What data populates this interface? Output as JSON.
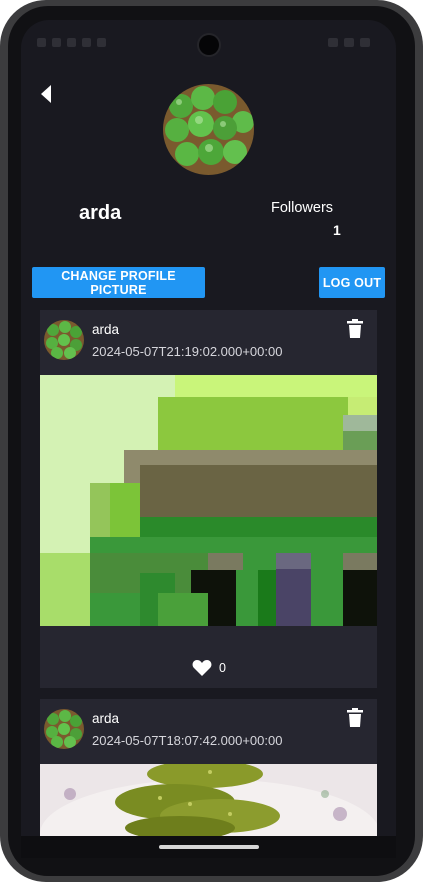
{
  "profile": {
    "username": "arda",
    "followers_label": "Followers",
    "followers_count": "1",
    "avatar_icon": "green-peas-avatar"
  },
  "buttons": {
    "change_picture": "CHANGE PROFILE PICTURE",
    "logout": "LOG OUT"
  },
  "posts": [
    {
      "username": "arda",
      "timestamp": "2024-05-07T21:19:02.000+00:00",
      "likes": "0",
      "image": "pixelated-green-image"
    },
    {
      "username": "arda",
      "timestamp": "2024-05-07T18:07:42.000+00:00",
      "image": "pickles-on-plate"
    }
  ],
  "colors": {
    "accent": "#2196f3",
    "background": "#191920",
    "card": "#262630"
  }
}
